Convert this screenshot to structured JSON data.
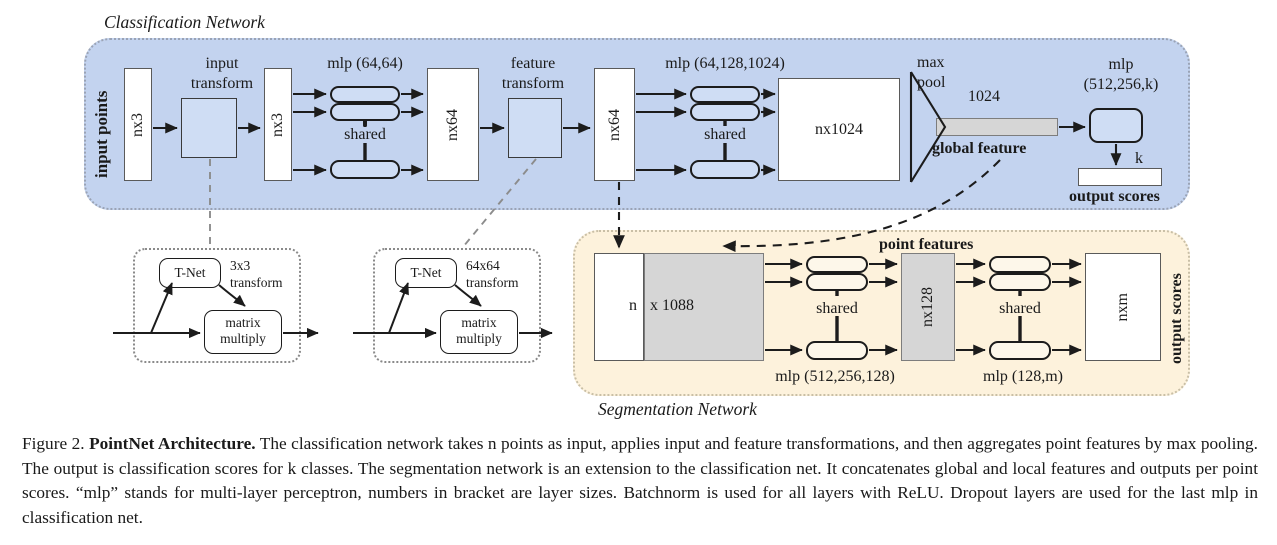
{
  "figure": {
    "label": "Figure 2.",
    "title": "PointNet Architecture.",
    "caption_rest": " The classification network takes n points as input, applies input and feature transformations, and then aggregates point features by max pooling. The output is classification scores for k classes. The segmentation network is an extension to the classification net. It concatenates global and local features and outputs per point scores. “mlp” stands for multi-layer perceptron, numbers in bracket are layer sizes. Batchnorm is used for all layers with ReLU. Dropout layers are used for the last mlp in classification net.",
    "caption_full": "Figure 2. PointNet Architecture. The classification network takes n points as input, applies input and feature transformations, and then aggregates point features by max pooling. The output is classification scores for k classes. The segmentation network is an extension to the classification net. It concatenates global and local features and outputs per point scores. “mlp” stands for multi-layer perceptron, numbers in bracket are layer sizes. Batchnorm is used for all layers with ReLU. Dropout layers are used for the last mlp in classification net.",
    "italic_vars": [
      "n",
      "k"
    ]
  },
  "classification_network": {
    "title": "Classification Network",
    "side_label": "input points",
    "input_block": "nx3",
    "input_transform_label_line1": "input",
    "input_transform_label_line2": "transform",
    "mlp1_label": "mlp (64,64)",
    "shared1_label": "shared",
    "after_mlp1_block": "nx3",
    "nx64_block": "nx64",
    "feature_transform_label_line1": "feature",
    "feature_transform_label_line2": "transform",
    "after_feature_block": "nx64",
    "mlp2_label": "mlp (64,128,1024)",
    "shared2_label": "shared",
    "nx1024_block": "nx1024",
    "maxpool_line1": "max",
    "maxpool_line2": "pool",
    "global_feature_size": "1024",
    "global_feature_label": "global feature",
    "mlp3_label_line1": "mlp",
    "mlp3_label_line2": "(512,256,k)",
    "k_label": "k",
    "output_scores_label": "output scores"
  },
  "tnet_input": {
    "tnet_label": "T-Net",
    "transform_line1": "3x3",
    "transform_line2": "transform",
    "matrix_line1": "matrix",
    "matrix_line2": "multiply"
  },
  "tnet_feature": {
    "tnet_label": "T-Net",
    "transform_line1": "64x64",
    "transform_line2": "transform",
    "matrix_line1": "matrix",
    "matrix_line2": "multiply"
  },
  "segmentation_network": {
    "title": "Segmentation Network",
    "concat_left_label": "n",
    "concat_right_label": "x 1088",
    "point_features_label": "point features",
    "mlp4_label": "mlp (512,256,128)",
    "shared3_label": "shared",
    "nx128_block": "nx128",
    "mlp5_label": "mlp (128,m)",
    "shared4_label": "shared",
    "nxm_block": "nxm",
    "side_label": "output scores"
  },
  "colors": {
    "classification_panel": "#c3d3ef",
    "segmentation_panel": "#fdf2dc",
    "mlp_box_blue": "#cfddf4",
    "mlp_box_cream": "#fdf7ea",
    "gray_block": "#d6d6d6",
    "white_block": "#ffffff",
    "stroke": "#1c1c1c",
    "background": "#ffffff"
  }
}
